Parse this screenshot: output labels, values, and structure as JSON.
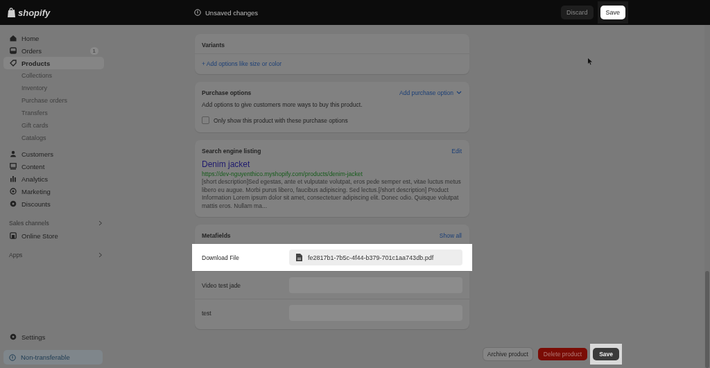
{
  "top_bar": {
    "logo": "shopify",
    "status": "Unsaved changes",
    "buttons": [
      {
        "label": "Discard",
        "kind": "secondary",
        "highlighted": false
      },
      {
        "label": "Save",
        "kind": "primary",
        "highlighted": true
      }
    ]
  },
  "sidebar": {
    "items": [
      {
        "label": "Home",
        "selected": false
      },
      {
        "label": "Orders",
        "badge": "1",
        "selected": false
      },
      {
        "label": "Products",
        "selected": true,
        "children": [
          {
            "label": "Collections"
          },
          {
            "label": "Inventory"
          },
          {
            "label": "Purchase orders"
          },
          {
            "label": "Transfers"
          },
          {
            "label": "Gift cards"
          },
          {
            "label": "Catalogs"
          }
        ]
      },
      {
        "label": "Customers",
        "selected": false
      },
      {
        "label": "Content",
        "selected": false
      },
      {
        "label": "Analytics",
        "selected": false
      },
      {
        "label": "Marketing",
        "selected": false
      },
      {
        "label": "Discounts",
        "selected": false
      }
    ],
    "sections": [
      {
        "title": "Sales channels",
        "items": [
          {
            "label": "Online Store"
          }
        ]
      },
      {
        "title": "Apps"
      }
    ],
    "settings": "Settings",
    "footer": "Non-transferable"
  },
  "variants": {
    "title": "Variants",
    "action": "+ Add options like size or color"
  },
  "purchase_options": {
    "title": "Purchase options",
    "action": "Add purchase option",
    "description": "Add options to give customers more ways to buy this product.",
    "checkbox": {
      "label": "Only show this product with these purchase options",
      "checked": false
    }
  },
  "seo": {
    "title": "Search engine listing",
    "action": "Edit",
    "page_title": "Denim jacket",
    "url": "https://dev-nguyenthico.myshopify.com/products/denim-jacket",
    "description": "[short description]Sed egestas, ante et vulputate volutpat, eros pede semper est, vitae luctus metus libero eu augue. Morbi purus libero, faucibus adipiscing. Sed lectus.[/short description] Product Information Lorem ipsum dolor sit amet, consectetuer adipiscing elit. Donec odio. Quisque volutpat mattis eros. Nullam ma..."
  },
  "metafields": {
    "title": "Metafields",
    "action": "Show all",
    "rows": [
      {
        "label": "Download File",
        "value": "fe2817b1-7b5c-4f44-b379-701c1aa743db.pdf",
        "highlighted": true
      },
      {
        "label": "Video test jade",
        "highlighted": false
      },
      {
        "label": "test",
        "highlighted": false
      }
    ]
  },
  "footer_buttons": [
    {
      "label": "Archive product",
      "kind": "secondary",
      "highlighted": false
    },
    {
      "label": "Delete product",
      "kind": "danger",
      "highlighted": false
    },
    {
      "label": "Save",
      "kind": "primary",
      "highlighted": true
    }
  ]
}
